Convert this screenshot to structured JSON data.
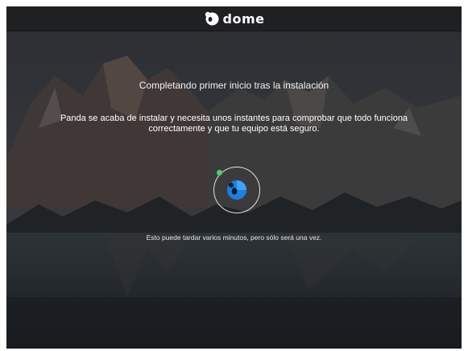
{
  "app": {
    "name": "dome",
    "logo_icon": "panda-logo-icon"
  },
  "main": {
    "heading": "Completando primer inicio tras la instalación",
    "description": "Panda se acaba de instalar y necesita unos instantes para comprobar que todo funciona correctamente y que tu equipo está seguro.",
    "note": "Esto puede tardar varios minutos, pero sólo será una vez."
  },
  "spinner": {
    "icon": "panda-progress-icon",
    "accent_color": "#4ccf6e",
    "logo_color": "#1e7fe0"
  },
  "colors": {
    "titlebar": "#1f2022",
    "text": "#ffffff"
  }
}
